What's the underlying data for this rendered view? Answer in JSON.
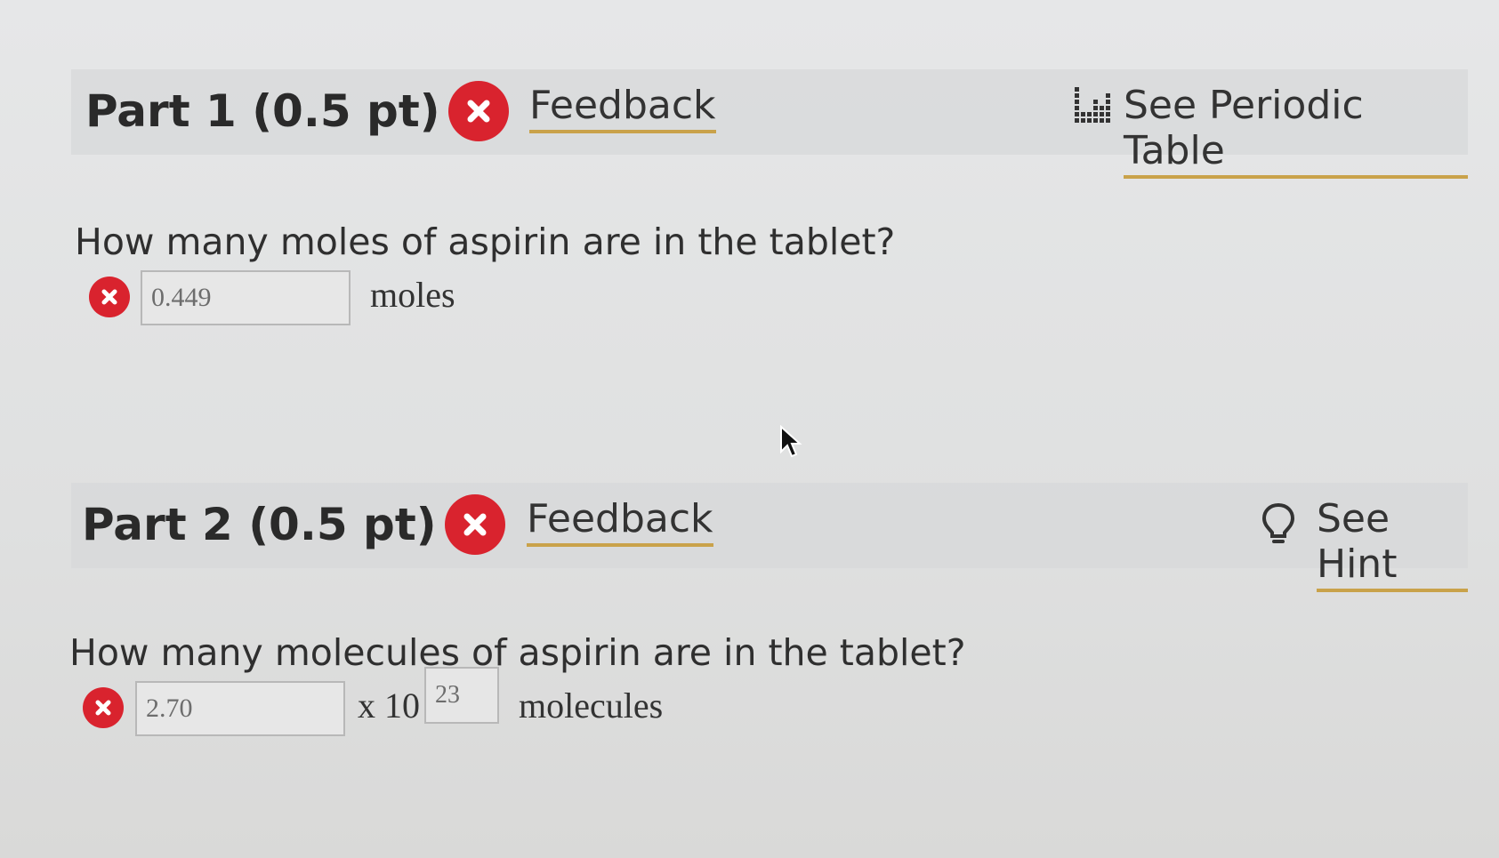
{
  "part1": {
    "title": "Part 1 (0.5 pt)",
    "feedback_label": "Feedback",
    "tool_label": "See Periodic Table",
    "tool_icon": "periodic-table-icon",
    "question": "How many moles of aspirin are in the tablet?",
    "answer_value": "0.449",
    "unit": "moles",
    "status": "incorrect"
  },
  "part2": {
    "title": "Part 2 (0.5 pt)",
    "feedback_label": "Feedback",
    "tool_label": "See Hint",
    "tool_icon": "lightbulb-icon",
    "question": "How many molecules of aspirin are in the tablet?",
    "answer_value": "2.70",
    "times_ten": "x 10",
    "exponent_value": "23",
    "unit": "molecules",
    "status": "incorrect"
  },
  "colors": {
    "incorrect": "#d9232e",
    "link_underline": "#c9a24a"
  }
}
